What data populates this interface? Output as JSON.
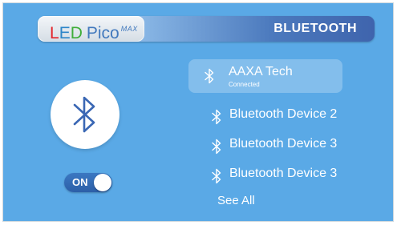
{
  "header": {
    "logo": {
      "part_l": "L",
      "part_e": "E",
      "part_d": "D",
      "pico": "Pico",
      "max": "MAX"
    },
    "title": "BLUETOOTH"
  },
  "bluetooth": {
    "icon": "bluetooth-icon",
    "toggle_label": "ON",
    "toggle_state": "on"
  },
  "devices": [
    {
      "name": "AAXA Tech",
      "status": "Connected",
      "selected": true
    },
    {
      "name": "Bluetooth Device 2"
    },
    {
      "name": "Bluetooth Device 3"
    },
    {
      "name": "Bluetooth Device 3"
    }
  ],
  "see_all_label": "See All",
  "colors": {
    "background": "#5aa9e6",
    "header_dark": "#3f64ad",
    "toggle": "#2c5fa8",
    "logo_red": "#e4262c",
    "logo_blue": "#2e86c9",
    "logo_green": "#3fae3a"
  }
}
